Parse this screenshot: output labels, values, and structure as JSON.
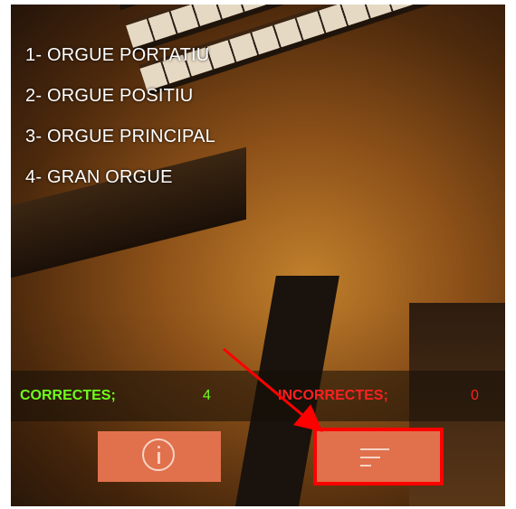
{
  "menu": {
    "items": [
      {
        "label": "1- ORGUE PORTATIU"
      },
      {
        "label": "2- ORGUE POSITIU"
      },
      {
        "label": "3- ORGUE PRINCIPAL"
      },
      {
        "label": "4- GRAN ORGUE"
      }
    ]
  },
  "score": {
    "correct_label": "CORRECTES;",
    "correct_value": "4",
    "incorrect_label": "INCORRECTES;",
    "incorrect_value": "0"
  },
  "buttons": {
    "info_icon": "info-circle-icon",
    "stats_icon": "sort-lines-icon"
  },
  "colors": {
    "correct": "#6fff1c",
    "incorrect": "#ff2020",
    "button": "#e0714c",
    "highlight": "#ff0000"
  }
}
